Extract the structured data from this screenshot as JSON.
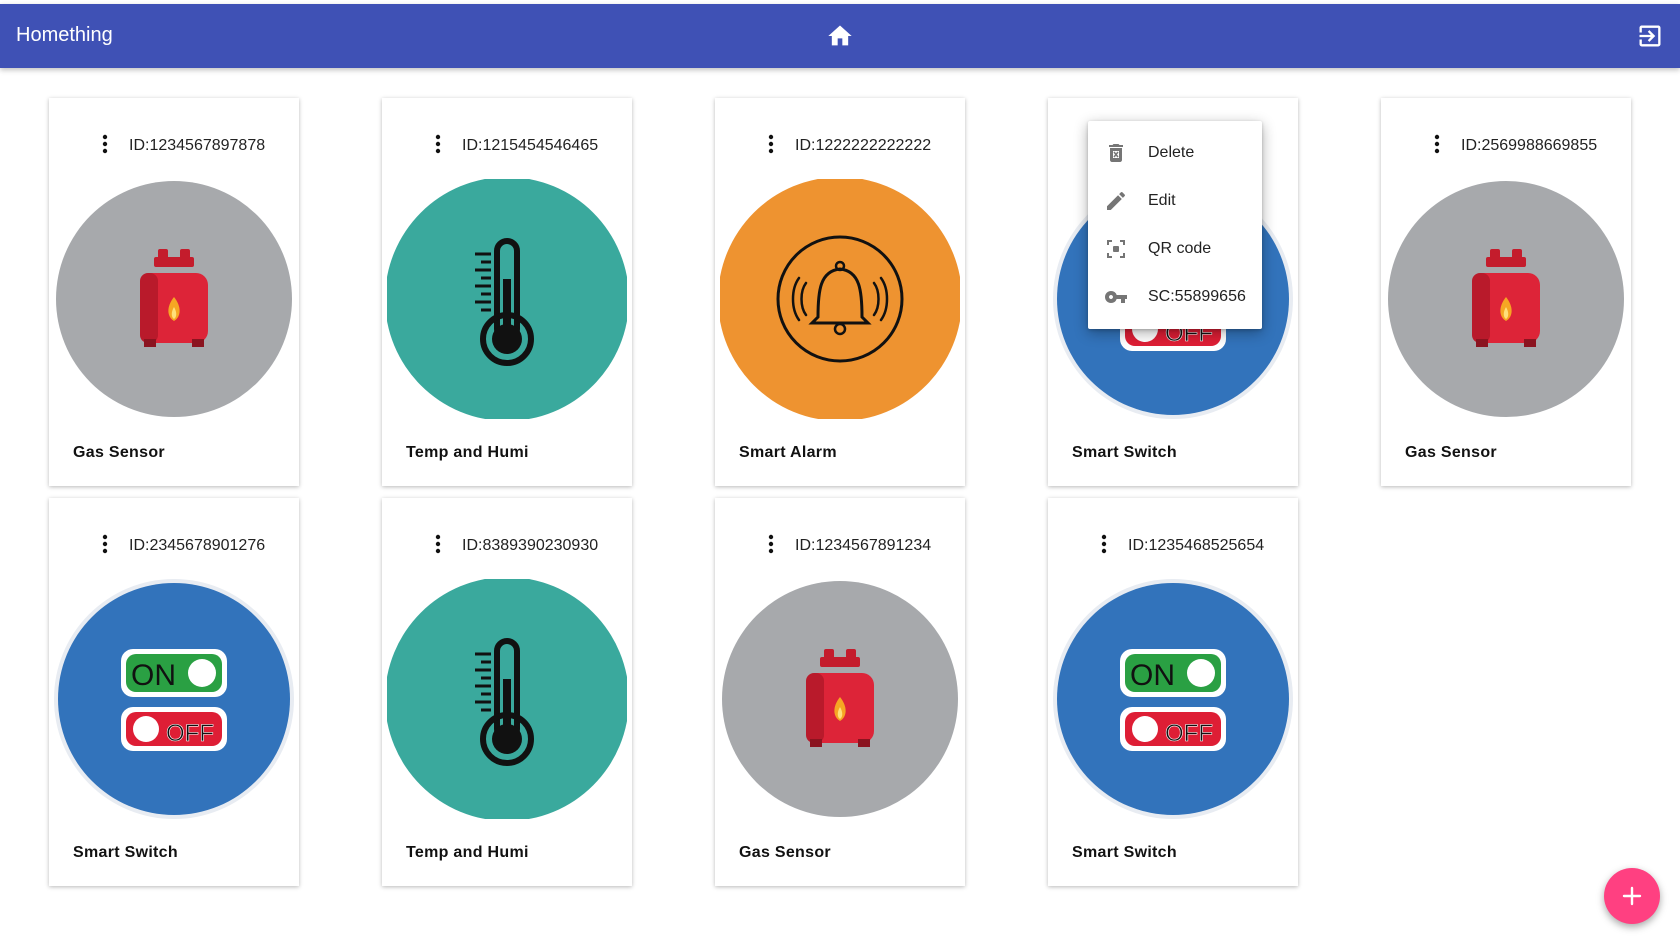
{
  "header": {
    "title": "Homething",
    "home_icon": "home-icon",
    "logout_icon": "logout-icon",
    "bar_color": "#3f51b5"
  },
  "devices": [
    {
      "id_label": "ID:1234567897878",
      "name": "Gas Sensor",
      "type": "gas"
    },
    {
      "id_label": "ID:1215454546465",
      "name": "Temp and Humi",
      "type": "temp"
    },
    {
      "id_label": "ID:1222222222222",
      "name": "Smart Alarm",
      "type": "alarm"
    },
    {
      "id_label": "",
      "name": "Smart Switch",
      "type": "switch"
    },
    {
      "id_label": "ID:2569988669855",
      "name": "Gas Sensor",
      "type": "gas"
    },
    {
      "id_label": "ID:2345678901276",
      "name": "Smart Switch",
      "type": "switch"
    },
    {
      "id_label": "ID:8389390230930",
      "name": "Temp and Humi",
      "type": "temp"
    },
    {
      "id_label": "ID:1234567891234",
      "name": "Gas Sensor",
      "type": "gas"
    },
    {
      "id_label": "ID:1235468525654",
      "name": "Smart Switch",
      "type": "switch"
    }
  ],
  "context_menu": {
    "items": [
      {
        "label": "Delete",
        "icon": "trash-icon"
      },
      {
        "label": "Edit",
        "icon": "pencil-icon"
      },
      {
        "label": "QR code",
        "icon": "qr-scan-icon"
      },
      {
        "label": "SC:55899656",
        "icon": "key-icon"
      }
    ]
  },
  "switch_labels": {
    "on": "ON",
    "off": "OFF"
  },
  "fab": {
    "label": "+",
    "color": "#ff4081"
  },
  "colors": {
    "gas_bg": "#a7a9ac",
    "temp_bg": "#3aa99d",
    "alarm_bg": "#ee9330",
    "switch_bg": "#3273bb",
    "switch_on": "#2aa043",
    "switch_off": "#de1e35"
  }
}
